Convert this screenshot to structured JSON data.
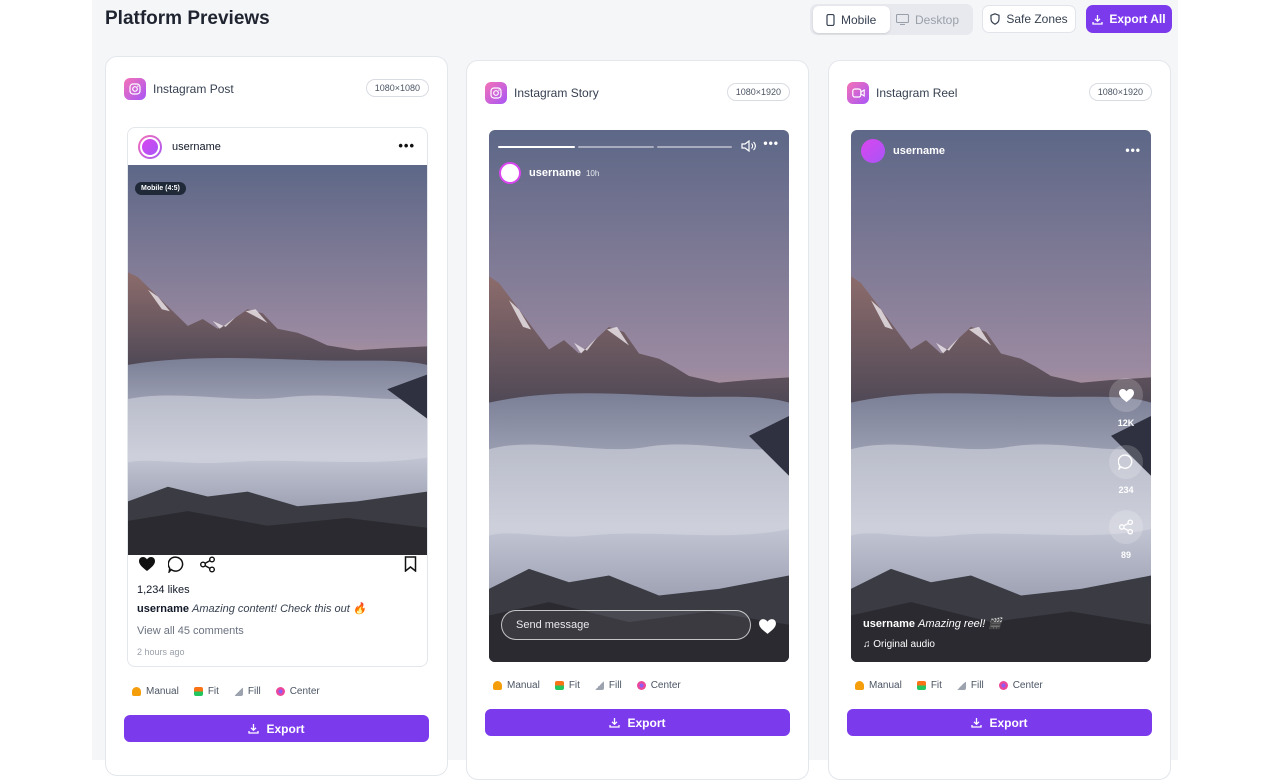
{
  "header": {
    "title": "Platform Previews",
    "view_mobile": "Mobile",
    "view_desktop": "Desktop",
    "safe_zones": "Safe Zones",
    "export_all": "Export All"
  },
  "tools": {
    "manual": "Manual",
    "fit": "Fit",
    "fill": "Fill",
    "center": "Center",
    "manual_color": "#f59e0b",
    "fit_color": "#22c55e",
    "fill_color": "#9ca3af",
    "center_color": "#ec4899"
  },
  "export_label": "Export",
  "accent": "#7c3aed",
  "post": {
    "platform": "Instagram Post",
    "size": "1080×1080",
    "username": "username",
    "badge": "Mobile (4:5)",
    "likes": "1,234 likes",
    "caption_user": "username",
    "caption_text": "Amazing content! Check this out 🔥",
    "comments": "View all 45 comments",
    "time": "2 hours ago"
  },
  "story": {
    "platform": "Instagram Story",
    "size": "1080×1920",
    "username": "username",
    "time": "10h",
    "message_placeholder": "Send message"
  },
  "reel": {
    "platform": "Instagram Reel",
    "size": "1080×1920",
    "username": "username",
    "likes": "12K",
    "comments": "234",
    "shares": "89",
    "caption_user": "username",
    "caption_text": "Amazing reel! 🎬",
    "audio": "♫ Original audio"
  }
}
